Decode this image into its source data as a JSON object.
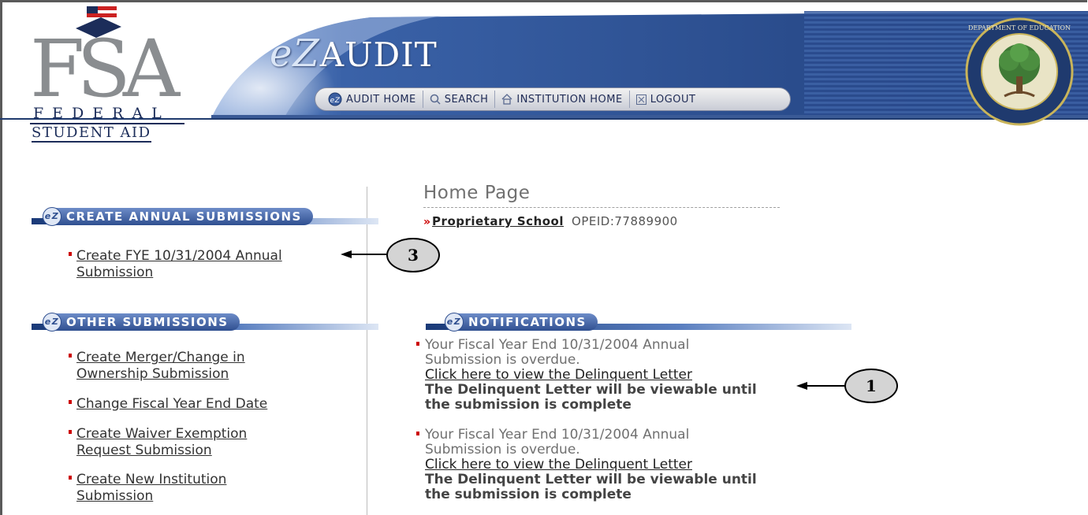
{
  "header": {
    "logo": {
      "letters": "FSA",
      "line1": "FEDERAL",
      "line2": "STUDENT AID"
    },
    "app_logo": {
      "prefix": "eZ",
      "name": "AUDIT"
    },
    "nav": [
      {
        "label": "AUDIT HOME",
        "icon": "ez-badge-icon"
      },
      {
        "label": "SEARCH",
        "icon": "search-icon"
      },
      {
        "label": "INSTITUTION HOME",
        "icon": "house-icon"
      },
      {
        "label": "LOGOUT",
        "icon": "close-box-icon"
      }
    ],
    "seal_text": "DEPARTMENT OF EDUCATION · UNITED STATES OF AMERICA"
  },
  "sidebar": {
    "sections": [
      {
        "title": "CREATE ANNUAL SUBMISSIONS",
        "items": [
          {
            "label_line1": "Create FYE 10/31/2004 Annual",
            "label_line2": "Submission"
          }
        ]
      },
      {
        "title": "OTHER SUBMISSIONS",
        "items": [
          {
            "label_line1": "Create Merger/Change in",
            "label_line2": "Ownership Submission"
          },
          {
            "label_line1": "Change Fiscal Year End Date",
            "label_line2": ""
          },
          {
            "label_line1": "Create Waiver Exemption",
            "label_line2": "Request Submission"
          },
          {
            "label_line1": "Create New Institution",
            "label_line2": "Submission"
          }
        ]
      }
    ]
  },
  "main": {
    "title": "Home Page",
    "school_marker": "»",
    "school_name": "Proprietary School",
    "opeid": "OPEID:77889900",
    "notifications_title": "NOTIFICATIONS",
    "notifications": [
      {
        "line1": "Your Fiscal Year End 10/31/2004 Annual",
        "line2": "Submission is overdue.",
        "link": "Click here to view the Delinquent Letter",
        "note1": "The Delinquent Letter will be viewable until",
        "note2": "the submission is complete"
      },
      {
        "line1": "Your Fiscal Year End 10/31/2004 Annual",
        "line2": "Submission is overdue.",
        "link": "Click here to view the Delinquent Letter",
        "note1": "The Delinquent Letter will be viewable until",
        "note2": "the submission is complete"
      }
    ]
  },
  "callouts": [
    {
      "label": "3"
    },
    {
      "label": "1"
    }
  ],
  "colors": {
    "banner_blue": "#2e4f8f",
    "bullet_red": "#cc0000",
    "link_text": "#333333"
  }
}
